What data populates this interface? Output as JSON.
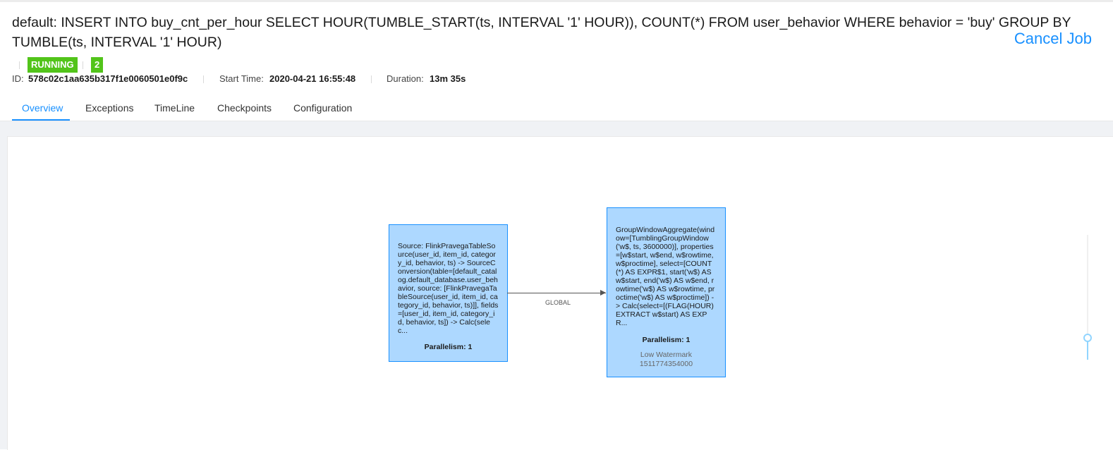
{
  "job": {
    "title": "default: INSERT INTO buy_cnt_per_hour SELECT HOUR(TUMBLE_START(ts, INTERVAL '1' HOUR)), COUNT(*) FROM user_behavior WHERE behavior = 'buy' GROUP BY TUMBLE(ts, INTERVAL '1' HOUR)",
    "cancel_label": "Cancel Job",
    "status": "RUNNING",
    "task_count": "2",
    "id_label": "ID:",
    "id_value": "578c02c1aa635b317f1e0060501e0f9c",
    "start_label": "Start Time:",
    "start_value": "2020-04-21 16:55:48",
    "duration_label": "Duration:",
    "duration_value": "13m 35s",
    "status_color": "#52c41a"
  },
  "tabs": [
    {
      "label": "Overview",
      "active": true
    },
    {
      "label": "Exceptions"
    },
    {
      "label": "TimeLine"
    },
    {
      "label": "Checkpoints"
    },
    {
      "label": "Configuration"
    }
  ],
  "graph": {
    "nodes": [
      {
        "description": "Source: FlinkPravegaTableSource(user_id, item_id, category_id, behavior, ts) -> SourceConversion(table=[default_catalog.default_database.user_behavior, source: [FlinkPravegaTableSource(user_id, item_id, category_id, behavior, ts)]], fields=[user_id, item_id, category_id, behavior, ts]) -> Calc(selec...",
        "parallelism": "Parallelism: 1"
      },
      {
        "description": "GroupWindowAggregate(window=[TumblingGroupWindow('w$, ts, 3600000)], properties=[w$start, w$end, w$rowtime, w$proctime], select=[COUNT(*) AS EXPR$1, start('w$) AS w$start, end('w$) AS w$end, rowtime('w$) AS w$rowtime, proctime('w$) AS w$proctime]) -> Calc(select=[(FLAG(HOUR) EXTRACT w$start) AS EXPR...",
        "parallelism": "Parallelism: 1",
        "watermark_label": "Low Watermark",
        "watermark_value": "1511774354000"
      }
    ],
    "edge_label": "GLOBAL"
  },
  "colors": {
    "accent": "#1890ff",
    "node_fill": "#add8ff"
  }
}
